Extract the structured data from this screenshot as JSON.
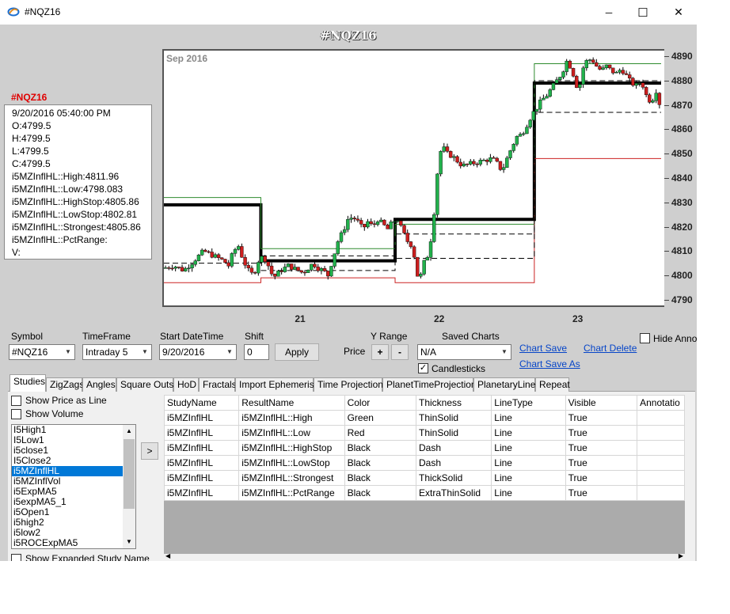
{
  "window": {
    "title": "#NQZ16",
    "minimize_glyph": "─",
    "maximize_glyph": "☐",
    "close_glyph": "✕"
  },
  "chart": {
    "title": "#NQZ16",
    "month_label": "Sep 2016"
  },
  "infobox": {
    "symbol": "#NQZ16",
    "lines": [
      "9/20/2016 05:40:00 PM",
      "O:4799.5",
      "H:4799.5",
      "L:4799.5",
      "C:4799.5",
      "i5MZInflHL::High:4811.96",
      "i5MZInflHL::Low:4798.083",
      "i5MZInflHL::HighStop:4805.86",
      "i5MZInflHL::LowStop:4802.81",
      "i5MZInflHL::Strongest:4805.86",
      "i5MZInflHL::PctRange:",
      "V:"
    ]
  },
  "chart_data": {
    "type": "candlestick",
    "title": "#NQZ16",
    "period_label": "Sep 2016",
    "y_ticks": [
      4890,
      4880,
      4870,
      4860,
      4850,
      4840,
      4830,
      4820,
      4810,
      4800,
      4790
    ],
    "ylim": [
      4787,
      4893
    ],
    "x_ticks": [
      {
        "label": "21",
        "pos": 0.275
      },
      {
        "label": "22",
        "pos": 0.552
      },
      {
        "label": "23",
        "pos": 0.828
      }
    ],
    "close_path": [
      [
        0.0,
        4803
      ],
      [
        0.02,
        4804
      ],
      [
        0.04,
        4802
      ],
      [
        0.06,
        4806
      ],
      [
        0.08,
        4810
      ],
      [
        0.1,
        4808
      ],
      [
        0.12,
        4806
      ],
      [
        0.13,
        4804
      ],
      [
        0.14,
        4810
      ],
      [
        0.15,
        4812
      ],
      [
        0.16,
        4806
      ],
      [
        0.17,
        4802
      ],
      [
        0.18,
        4800
      ],
      [
        0.19,
        4806
      ],
      [
        0.2,
        4808
      ],
      [
        0.21,
        4804
      ],
      [
        0.22,
        4799
      ],
      [
        0.235,
        4802
      ],
      [
        0.25,
        4804
      ],
      [
        0.27,
        4802
      ],
      [
        0.28,
        4801
      ],
      [
        0.29,
        4803
      ],
      [
        0.3,
        4805
      ],
      [
        0.31,
        4803
      ],
      [
        0.32,
        4802
      ],
      [
        0.33,
        4800
      ],
      [
        0.34,
        4807
      ],
      [
        0.35,
        4814
      ],
      [
        0.36,
        4818
      ],
      [
        0.37,
        4823
      ],
      [
        0.38,
        4824
      ],
      [
        0.39,
        4822
      ],
      [
        0.4,
        4819
      ],
      [
        0.41,
        4822
      ],
      [
        0.42,
        4820
      ],
      [
        0.43,
        4823
      ],
      [
        0.44,
        4821
      ],
      [
        0.45,
        4819
      ],
      [
        0.46,
        4822
      ],
      [
        0.47,
        4823
      ],
      [
        0.48,
        4818
      ],
      [
        0.49,
        4814
      ],
      [
        0.5,
        4812
      ],
      [
        0.505,
        4806
      ],
      [
        0.51,
        4800
      ],
      [
        0.515,
        4798
      ],
      [
        0.52,
        4804
      ],
      [
        0.53,
        4808
      ],
      [
        0.54,
        4818
      ],
      [
        0.545,
        4830
      ],
      [
        0.55,
        4842
      ],
      [
        0.555,
        4850
      ],
      [
        0.56,
        4853
      ],
      [
        0.57,
        4850
      ],
      [
        0.58,
        4849
      ],
      [
        0.6,
        4845
      ],
      [
        0.62,
        4846
      ],
      [
        0.64,
        4847
      ],
      [
        0.66,
        4848
      ],
      [
        0.67,
        4846
      ],
      [
        0.68,
        4843
      ],
      [
        0.69,
        4848
      ],
      [
        0.7,
        4853
      ],
      [
        0.71,
        4857
      ],
      [
        0.72,
        4858
      ],
      [
        0.73,
        4862
      ],
      [
        0.74,
        4866
      ],
      [
        0.75,
        4869
      ],
      [
        0.76,
        4872
      ],
      [
        0.77,
        4874
      ],
      [
        0.78,
        4877
      ],
      [
        0.79,
        4880
      ],
      [
        0.8,
        4883
      ],
      [
        0.81,
        4888
      ],
      [
        0.82,
        4885
      ],
      [
        0.83,
        4878
      ],
      [
        0.835,
        4876
      ],
      [
        0.84,
        4884
      ],
      [
        0.85,
        4888
      ],
      [
        0.86,
        4889
      ],
      [
        0.87,
        4886
      ],
      [
        0.88,
        4884
      ],
      [
        0.89,
        4886
      ],
      [
        0.9,
        4884
      ],
      [
        0.91,
        4883
      ],
      [
        0.92,
        4885
      ],
      [
        0.93,
        4882
      ],
      [
        0.94,
        4879
      ],
      [
        0.95,
        4878
      ],
      [
        0.96,
        4880
      ],
      [
        0.97,
        4874
      ],
      [
        0.98,
        4871
      ],
      [
        0.99,
        4876
      ],
      [
        1.0,
        4868
      ]
    ],
    "step_lines": [
      {
        "name": "i5MZInflHL::Strongest",
        "style": "thick",
        "color": "#000000",
        "points": [
          [
            0.0,
            4829
          ],
          [
            0.195,
            4829
          ],
          [
            0.195,
            4806
          ],
          [
            0.465,
            4806
          ],
          [
            0.465,
            4823
          ],
          [
            0.745,
            4823
          ],
          [
            0.745,
            4879
          ],
          [
            1.0,
            4879
          ]
        ]
      },
      {
        "name": "i5MZInflHL::High",
        "style": "thin",
        "color": "#2e8b2e",
        "points": [
          [
            0.0,
            4832
          ],
          [
            0.195,
            4832
          ],
          [
            0.195,
            4811
          ],
          [
            0.465,
            4811
          ],
          [
            0.465,
            4821
          ],
          [
            0.745,
            4821
          ],
          [
            0.745,
            4887
          ],
          [
            1.0,
            4887
          ]
        ]
      },
      {
        "name": "i5MZInflHL::Low",
        "style": "thin",
        "color": "#cc2222",
        "points": [
          [
            0.0,
            4797
          ],
          [
            0.195,
            4797
          ],
          [
            0.195,
            4799
          ],
          [
            0.465,
            4799
          ],
          [
            0.465,
            4797
          ],
          [
            0.745,
            4797
          ],
          [
            0.745,
            4848
          ],
          [
            1.0,
            4848
          ]
        ]
      },
      {
        "name": "i5MZInflHL::HighStop",
        "style": "dash",
        "color": "#000000",
        "points": [
          [
            0.0,
            4805
          ],
          [
            0.195,
            4805
          ],
          [
            0.195,
            4808
          ],
          [
            0.465,
            4808
          ],
          [
            0.465,
            4817
          ],
          [
            0.745,
            4817
          ],
          [
            0.745,
            4880
          ],
          [
            1.0,
            4880
          ]
        ]
      },
      {
        "name": "i5MZInflHL::LowStop",
        "style": "dash",
        "color": "#000000",
        "points": [
          [
            0.195,
            4802
          ],
          [
            0.465,
            4802
          ],
          [
            0.465,
            4807
          ],
          [
            0.745,
            4807
          ],
          [
            0.745,
            4867
          ],
          [
            1.0,
            4867
          ]
        ]
      }
    ]
  },
  "controls": {
    "symbol_label": "Symbol",
    "symbol_value": "#NQZ16",
    "timeframe_label": "TimeFrame",
    "timeframe_value": "Intraday 5",
    "start_label": "Start DateTime",
    "start_value": "9/20/2016",
    "shift_label": "Shift",
    "shift_value": "0",
    "apply_label": "Apply",
    "yrange_label": "Y Range",
    "price_label": "Price",
    "plus_label": "+",
    "minus_label": "-",
    "saved_label": "Saved Charts",
    "saved_value": "N/A",
    "candlesticks_label": "Candlesticks",
    "chart_save": "Chart Save",
    "chart_save_as": "Chart Save As",
    "chart_delete": "Chart Delete",
    "hide_annot": "Hide Annot"
  },
  "tabs": [
    "Studies",
    "ZigZags",
    "Angles",
    "Square Outs",
    "HoD",
    "Fractals",
    "Import Ephemeris",
    "Time Projections",
    "PlanetTimeProjections",
    "PlanetaryLines",
    "Repeat"
  ],
  "studies": {
    "show_price_line": "Show Price as Line",
    "show_volume": "Show Volume",
    "show_expanded": "Show Expanded Study Name",
    "add_button": ">",
    "list": [
      "I5High1",
      "I5Low1",
      "i5close1",
      "I5Close2",
      "i5MZInflHL",
      "i5MZInflVol",
      "i5ExpMA5",
      "i5expMA5_1",
      "i5Open1",
      "i5high2",
      "i5low2",
      "i5ROCExpMA5"
    ],
    "selected_index": 4
  },
  "grid": {
    "columns": [
      "StudyName",
      "ResultName",
      "Color",
      "Thickness",
      "LineType",
      "Visible",
      "Annotatio"
    ],
    "rows": [
      [
        "i5MZInflHL",
        "i5MZInflHL::High",
        "Green",
        "ThinSolid",
        "Line",
        "True",
        ""
      ],
      [
        "i5MZInflHL",
        "i5MZInflHL::Low",
        "Red",
        "ThinSolid",
        "Line",
        "True",
        ""
      ],
      [
        "i5MZInflHL",
        "i5MZInflHL::HighStop",
        "Black",
        "Dash",
        "Line",
        "True",
        ""
      ],
      [
        "i5MZInflHL",
        "i5MZInflHL::LowStop",
        "Black",
        "Dash",
        "Line",
        "True",
        ""
      ],
      [
        "i5MZInflHL",
        "i5MZInflHL::Strongest",
        "Black",
        "ThickSolid",
        "Line",
        "True",
        ""
      ],
      [
        "i5MZInflHL",
        "i5MZInflHL::PctRange",
        "Black",
        "ExtraThinSolid",
        "Line",
        "True",
        ""
      ]
    ]
  },
  "colors": {
    "up_candle": "#22b14c",
    "down_candle": "#cc1f1f",
    "link": "#0645c8",
    "selection": "#0078d7"
  }
}
